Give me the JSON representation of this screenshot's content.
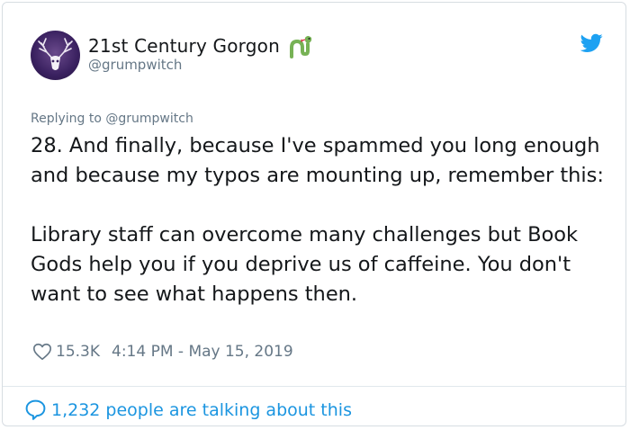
{
  "user": {
    "display_name": "21st Century Gorgon",
    "handle": "@grumpwitch",
    "avatar_icon": "deer-skull-avatar",
    "name_emoji_icon": "snake-icon"
  },
  "tweet": {
    "replying_to": "Replying to @grumpwitch",
    "text": "28. And finally, because I've spammed you long enough and because my typos are mounting up, remember this:\n\nLibrary staff can overcome many challenges but Book Gods help you if you deprive us of caffeine. You don't want to see what happens then.",
    "likes": "15.3K",
    "timestamp": "4:14 PM - May 15, 2019"
  },
  "footer": {
    "talking": "1,232 people are talking about this"
  },
  "colors": {
    "brand": "#1da1f2",
    "link": "#1b95e0",
    "muted": "#657786",
    "text": "#14171a"
  }
}
